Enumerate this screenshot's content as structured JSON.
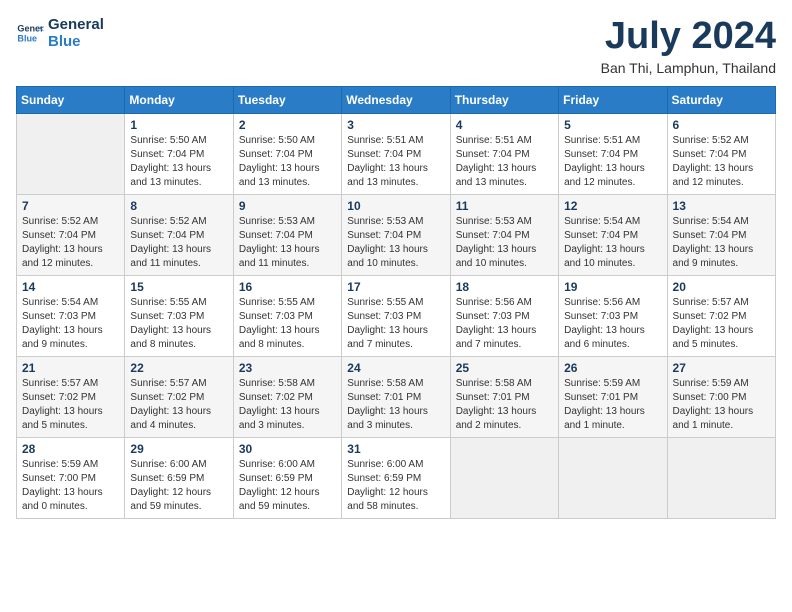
{
  "header": {
    "logo_line1": "General",
    "logo_line2": "Blue",
    "month": "July 2024",
    "location": "Ban Thi, Lamphun, Thailand"
  },
  "weekdays": [
    "Sunday",
    "Monday",
    "Tuesday",
    "Wednesday",
    "Thursday",
    "Friday",
    "Saturday"
  ],
  "weeks": [
    [
      {
        "day": "",
        "info": ""
      },
      {
        "day": "1",
        "info": "Sunrise: 5:50 AM\nSunset: 7:04 PM\nDaylight: 13 hours\nand 13 minutes."
      },
      {
        "day": "2",
        "info": "Sunrise: 5:50 AM\nSunset: 7:04 PM\nDaylight: 13 hours\nand 13 minutes."
      },
      {
        "day": "3",
        "info": "Sunrise: 5:51 AM\nSunset: 7:04 PM\nDaylight: 13 hours\nand 13 minutes."
      },
      {
        "day": "4",
        "info": "Sunrise: 5:51 AM\nSunset: 7:04 PM\nDaylight: 13 hours\nand 13 minutes."
      },
      {
        "day": "5",
        "info": "Sunrise: 5:51 AM\nSunset: 7:04 PM\nDaylight: 13 hours\nand 12 minutes."
      },
      {
        "day": "6",
        "info": "Sunrise: 5:52 AM\nSunset: 7:04 PM\nDaylight: 13 hours\nand 12 minutes."
      }
    ],
    [
      {
        "day": "7",
        "info": "Sunrise: 5:52 AM\nSunset: 7:04 PM\nDaylight: 13 hours\nand 12 minutes."
      },
      {
        "day": "8",
        "info": "Sunrise: 5:52 AM\nSunset: 7:04 PM\nDaylight: 13 hours\nand 11 minutes."
      },
      {
        "day": "9",
        "info": "Sunrise: 5:53 AM\nSunset: 7:04 PM\nDaylight: 13 hours\nand 11 minutes."
      },
      {
        "day": "10",
        "info": "Sunrise: 5:53 AM\nSunset: 7:04 PM\nDaylight: 13 hours\nand 10 minutes."
      },
      {
        "day": "11",
        "info": "Sunrise: 5:53 AM\nSunset: 7:04 PM\nDaylight: 13 hours\nand 10 minutes."
      },
      {
        "day": "12",
        "info": "Sunrise: 5:54 AM\nSunset: 7:04 PM\nDaylight: 13 hours\nand 10 minutes."
      },
      {
        "day": "13",
        "info": "Sunrise: 5:54 AM\nSunset: 7:04 PM\nDaylight: 13 hours\nand 9 minutes."
      }
    ],
    [
      {
        "day": "14",
        "info": "Sunrise: 5:54 AM\nSunset: 7:03 PM\nDaylight: 13 hours\nand 9 minutes."
      },
      {
        "day": "15",
        "info": "Sunrise: 5:55 AM\nSunset: 7:03 PM\nDaylight: 13 hours\nand 8 minutes."
      },
      {
        "day": "16",
        "info": "Sunrise: 5:55 AM\nSunset: 7:03 PM\nDaylight: 13 hours\nand 8 minutes."
      },
      {
        "day": "17",
        "info": "Sunrise: 5:55 AM\nSunset: 7:03 PM\nDaylight: 13 hours\nand 7 minutes."
      },
      {
        "day": "18",
        "info": "Sunrise: 5:56 AM\nSunset: 7:03 PM\nDaylight: 13 hours\nand 7 minutes."
      },
      {
        "day": "19",
        "info": "Sunrise: 5:56 AM\nSunset: 7:03 PM\nDaylight: 13 hours\nand 6 minutes."
      },
      {
        "day": "20",
        "info": "Sunrise: 5:57 AM\nSunset: 7:02 PM\nDaylight: 13 hours\nand 5 minutes."
      }
    ],
    [
      {
        "day": "21",
        "info": "Sunrise: 5:57 AM\nSunset: 7:02 PM\nDaylight: 13 hours\nand 5 minutes."
      },
      {
        "day": "22",
        "info": "Sunrise: 5:57 AM\nSunset: 7:02 PM\nDaylight: 13 hours\nand 4 minutes."
      },
      {
        "day": "23",
        "info": "Sunrise: 5:58 AM\nSunset: 7:02 PM\nDaylight: 13 hours\nand 3 minutes."
      },
      {
        "day": "24",
        "info": "Sunrise: 5:58 AM\nSunset: 7:01 PM\nDaylight: 13 hours\nand 3 minutes."
      },
      {
        "day": "25",
        "info": "Sunrise: 5:58 AM\nSunset: 7:01 PM\nDaylight: 13 hours\nand 2 minutes."
      },
      {
        "day": "26",
        "info": "Sunrise: 5:59 AM\nSunset: 7:01 PM\nDaylight: 13 hours\nand 1 minute."
      },
      {
        "day": "27",
        "info": "Sunrise: 5:59 AM\nSunset: 7:00 PM\nDaylight: 13 hours\nand 1 minute."
      }
    ],
    [
      {
        "day": "28",
        "info": "Sunrise: 5:59 AM\nSunset: 7:00 PM\nDaylight: 13 hours\nand 0 minutes."
      },
      {
        "day": "29",
        "info": "Sunrise: 6:00 AM\nSunset: 6:59 PM\nDaylight: 12 hours\nand 59 minutes."
      },
      {
        "day": "30",
        "info": "Sunrise: 6:00 AM\nSunset: 6:59 PM\nDaylight: 12 hours\nand 59 minutes."
      },
      {
        "day": "31",
        "info": "Sunrise: 6:00 AM\nSunset: 6:59 PM\nDaylight: 12 hours\nand 58 minutes."
      },
      {
        "day": "",
        "info": ""
      },
      {
        "day": "",
        "info": ""
      },
      {
        "day": "",
        "info": ""
      }
    ]
  ]
}
